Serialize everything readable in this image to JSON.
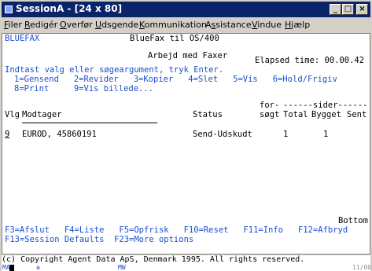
{
  "window": {
    "title": "SessionA - [24 x 80]",
    "minimize": "_",
    "maximize": "□",
    "close": "×"
  },
  "menu": [
    {
      "pre": "",
      "u": "F",
      "post": "iler"
    },
    {
      "pre": "",
      "u": "R",
      "post": "edigér"
    },
    {
      "pre": "",
      "u": "O",
      "post": "verfør"
    },
    {
      "pre": "",
      "u": "U",
      "post": "dsgende"
    },
    {
      "pre": "",
      "u": "K",
      "post": "ommunikation"
    },
    {
      "pre": "A",
      "u": "s",
      "post": "sistance"
    },
    {
      "pre": "",
      "u": "V",
      "post": "indue"
    },
    {
      "pre": "",
      "u": "H",
      "post": "jælp"
    }
  ],
  "screen": {
    "program": "BLUEFAX",
    "app_title": "BlueFax til OS/400",
    "heading": "Arbejd med Faxer",
    "elapsed": "Elapsed time: 00.00.42",
    "instruction": "Indtast valg eller søgeargument, tryk Enter.",
    "options_row1": "1=Gensend   2=Revider   3=Kopier   4=Slet   5=Vis   6=Hold/Frigiv",
    "options_row2": "8=Print     9=Vis billede...",
    "col_header_top_for": "for-",
    "col_header_top_sider": "------sider------",
    "col_vlg": "Vlg",
    "col_modtager": "Modtager",
    "col_status": "Status",
    "col_sogt": "søgt",
    "col_total": "Total",
    "col_bygget": "Bygget",
    "col_sent": "Sent",
    "rows": [
      {
        "vlg": "9",
        "modtager": "EUROD, 45860191",
        "status": "Send-Udskudt",
        "sogt": "",
        "total": "1",
        "bygget": "1",
        "sent": ""
      }
    ],
    "bottom_marker": "Bottom",
    "fkeys_row1": "F3=Afslut   F4=Liste   F5=Opfrisk   F10=Reset   F11=Info   F12=Afbryd",
    "fkeys_row2": "F13=Session Defaults  F23=More options"
  },
  "copyright": "(c) Copyright Agent Data ApS, Denmark 1995. All rights reserved.",
  "status": {
    "ma": "MA",
    "a": "a",
    "mw": "MW",
    "pos": "11/00"
  },
  "colors": {
    "title_bg": "#0a246a",
    "field_blue": "#1a4fcf",
    "window_bg": "#d4d0c8"
  }
}
